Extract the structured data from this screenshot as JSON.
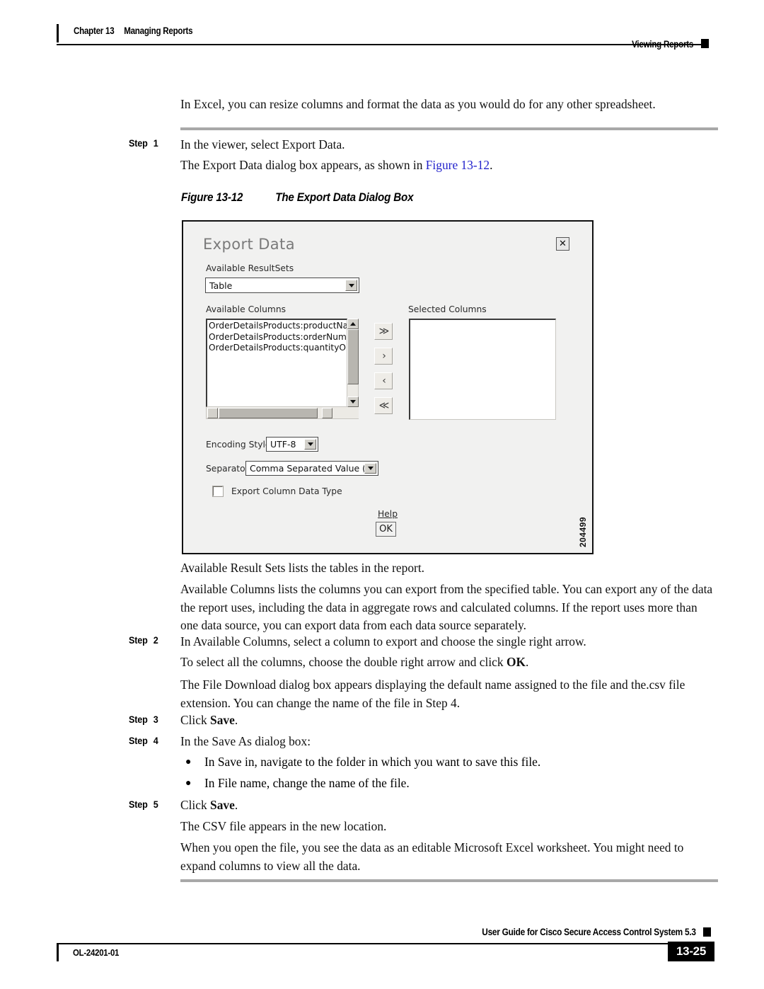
{
  "header": {
    "chapter_number": "Chapter 13",
    "chapter_title": "Managing Reports",
    "section_title": "Viewing Reports"
  },
  "body": {
    "intro_paragraph": "In Excel, you can resize columns and format the data as you would do for any other spreadsheet.",
    "step1_label": "Step",
    "step1_number": "1",
    "step1_text": "In the viewer, select Export Data.",
    "step1_result_prefix": "The Export Data dialog box appears, as shown in ",
    "step1_result_xref": "Figure 13-12",
    "step1_result_suffix": ".",
    "figure_caption_number": "Figure 13-12",
    "figure_caption_title": "The Export Data Dialog Box",
    "after_figure_p1": "Available Result Sets lists the tables in the report.",
    "after_figure_p2": "Available Columns lists the columns you can export from the specified table. You can export any of the data the report uses, including the data in aggregate rows and calculated columns. If the report uses more than one data source, you can export data from each data source separately.",
    "step2_label": "Step",
    "step2_number": "2",
    "step2_text": "In Available Columns, select a column to export and choose the single right arrow.",
    "step2_sub_prefix": "To select all the columns, choose the double right arrow and click ",
    "step2_sub_bold": "OK",
    "step2_sub_suffix": ".",
    "step2_result": "The File Download dialog box appears displaying the default name assigned to the file and the.csv file extension. You can change the name of the file in Step 4.",
    "step3_label": "Step",
    "step3_number": "3",
    "step3_text_prefix": "Click ",
    "step3_text_bold": "Save",
    "step3_text_suffix": ".",
    "step4_label": "Step",
    "step4_number": "4",
    "step4_text": "In the Save As dialog box:",
    "bullet1": "In Save in, navigate to the folder in which you want to save this file.",
    "bullet2": "In File name, change the name of the file.",
    "step5_label": "Step",
    "step5_number": "5",
    "step5_text_prefix": "Click ",
    "step5_text_bold": "Save",
    "step5_text_suffix": ".",
    "step5_result1": "The CSV file appears in the new location.",
    "step5_result2": "When you open the file, you see the data as an editable Microsoft Excel worksheet. You might need to expand columns to view all the data."
  },
  "figure": {
    "art_id": "204499",
    "dialog": {
      "title": "Export Data",
      "close_label": "✕",
      "available_resultsets_label": "Available ResultSets",
      "available_resultsets_value": "Table",
      "available_columns_label": "Available Columns",
      "available_columns_items": [
        "OrderDetailsProducts:productName",
        "OrderDetailsProducts:orderNumber",
        "OrderDetailsProducts:quantityOrdere"
      ],
      "selected_columns_label": "Selected Columns",
      "selected_columns_items": [],
      "transfer_buttons": [
        {
          "name": "move-all-right",
          "glyph": "≫"
        },
        {
          "name": "move-right",
          "glyph": "›"
        },
        {
          "name": "move-left",
          "glyph": "‹"
        },
        {
          "name": "move-all-left",
          "glyph": "≪"
        }
      ],
      "encoding_style_label": "Encoding Style",
      "encoding_style_value": "UTF-8",
      "separator_label": "Separator",
      "separator_value": "Comma Separated Value ( CSV )",
      "export_column_data_type_label": "Export Column Data Type",
      "export_column_data_type_checked": false,
      "help_label": "Help",
      "ok_label": "OK"
    }
  },
  "footer": {
    "doc_id": "OL-24201-01",
    "guide_title": "User Guide for Cisco Secure Access Control System 5.3",
    "page_number": "13-25"
  }
}
